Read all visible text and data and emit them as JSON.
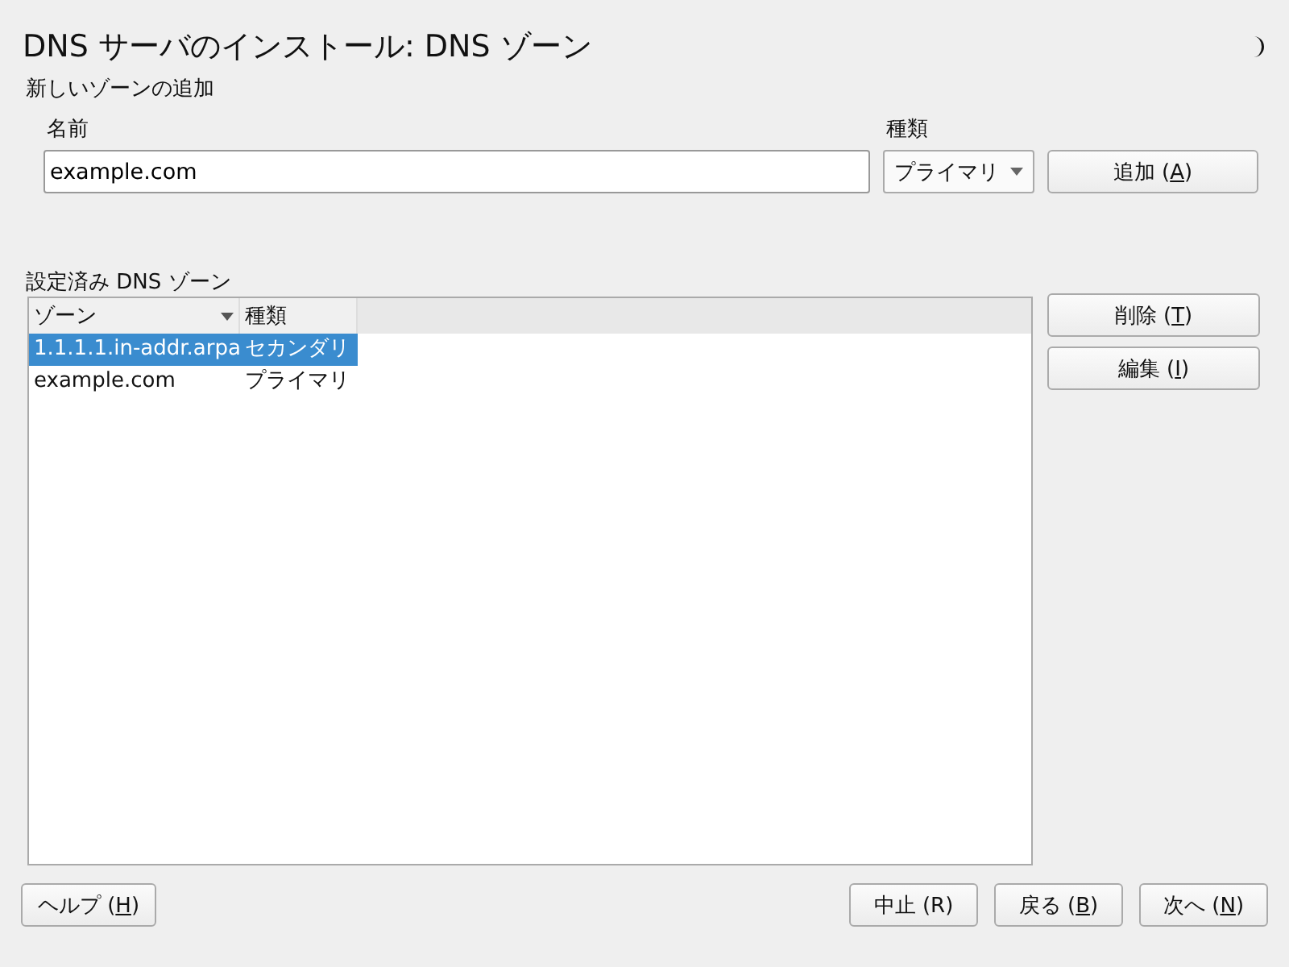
{
  "window": {
    "title": "DNS サーバのインストール: DNS ゾーン"
  },
  "add_zone": {
    "heading": "新しいゾーンの追加",
    "name_label": "名前",
    "name_value": "example.com",
    "type_label": "種類",
    "type_value": "プライマリ",
    "add_button": {
      "before": "追加 (",
      "mnemonic": "A",
      "after": ")"
    }
  },
  "zones": {
    "heading": "設定済み DNS ゾーン",
    "columns": [
      {
        "label": "ゾーン",
        "sorted": true
      },
      {
        "label": "種類",
        "sorted": false
      }
    ],
    "rows": [
      {
        "cells": [
          "1.1.1.1.in-addr.arpa",
          "セカンダリ"
        ],
        "selected": true
      },
      {
        "cells": [
          "example.com",
          "プライマリ"
        ],
        "selected": false
      }
    ],
    "buttons": [
      {
        "before": "削除 (",
        "mnemonic": "T",
        "after": ")"
      },
      {
        "before": "編集 (",
        "mnemonic": "I",
        "after": ")"
      }
    ]
  },
  "footer": {
    "help": {
      "before": "ヘルプ (",
      "mnemonic": "H",
      "after": ")"
    },
    "buttons": [
      {
        "before": "中止 (R)"
      },
      {
        "before": "戻る (",
        "mnemonic": "B",
        "after": ")"
      },
      {
        "before": "次へ (",
        "mnemonic": "N",
        "after": ")"
      }
    ]
  }
}
